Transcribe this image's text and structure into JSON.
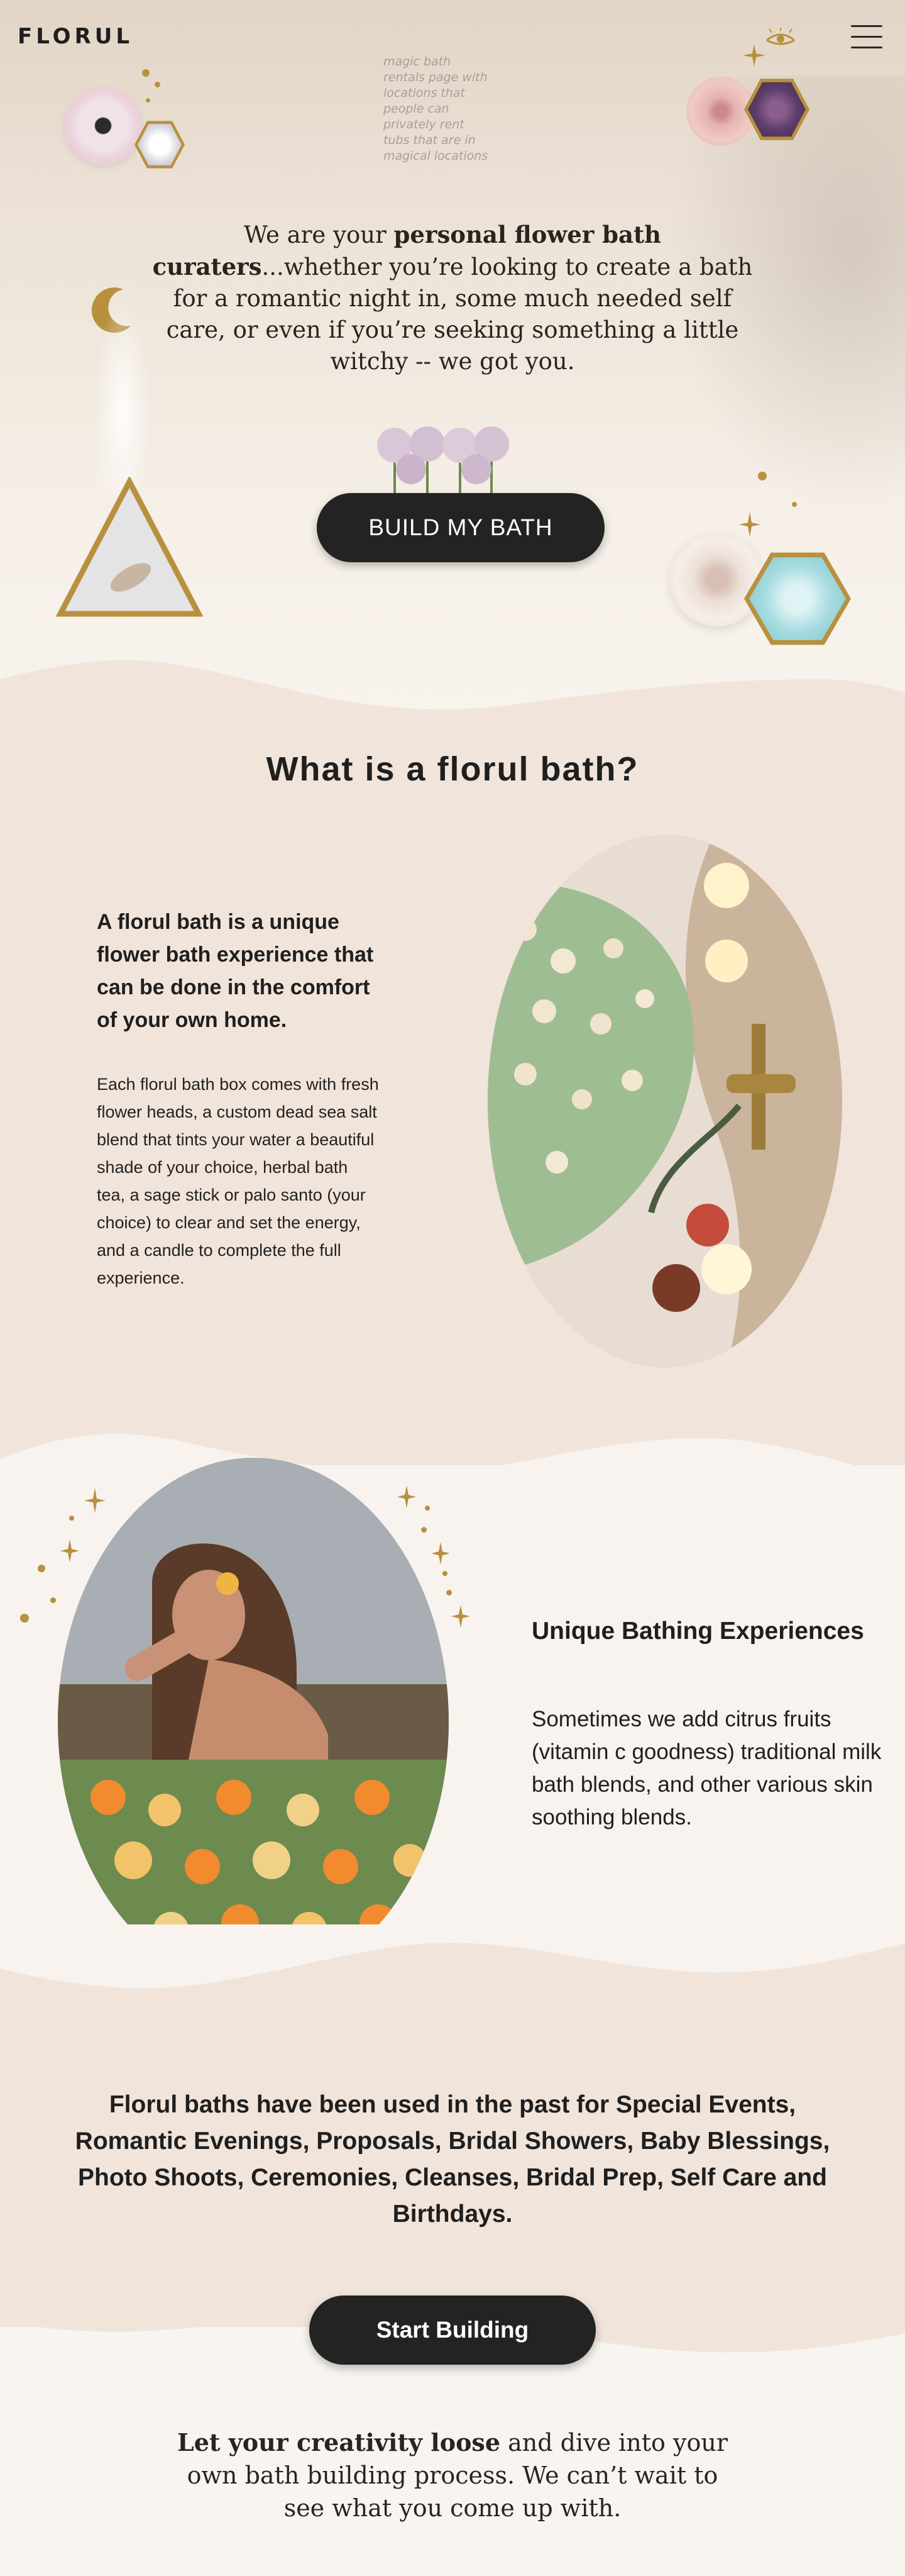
{
  "header": {
    "logo": "FLORUL",
    "note": "magic bath rentals page with locations that people can privately rent tubs that are in magical locations"
  },
  "hero": {
    "copy_bold": "personal flower bath curaters",
    "copy_before": "We are your ",
    "copy_after": "...whether you’re looking to create a bath for a romantic night in, some much needed self care, or even if you’re seeking something a little witchy -- we got you.",
    "button_label": "BUILD MY BATH"
  },
  "about": {
    "title": "What is a florul bath?",
    "lead": "A florul bath is a unique flower bath experience that can be done in the comfort of your own home.",
    "body": "Each florul bath box comes with fresh flower heads, a custom dead sea salt blend that tints your water a beautiful shade of your choice, herbal bath tea, a sage stick or palo santo (your choice) to clear and set the energy, and a candle to complete the full experience."
  },
  "unique": {
    "heading": "Unique Bathing Experiences",
    "body": "Sometimes we add citrus fruits (vitamin c goodness) traditional milk bath blends, and other various skin soothing blends."
  },
  "occasions": {
    "text": "Florul baths have been used in the past for Special Events, Romantic Evenings, Proposals, Bridal Showers, Baby Blessings, Photo Shoots, Ceremonies, Cleanses, Bridal Prep, Self Care and Birthdays.",
    "button_label": "Start Building"
  },
  "footer": {
    "copy_bold": "Let your creativity loose",
    "copy_after": " and dive into your own bath building process. We can’t wait to see what you come up with."
  },
  "icons": [
    "menu-icon",
    "moon-icon",
    "eye-icon",
    "sparkle-icon",
    "flower-icon",
    "triangle-frame-icon",
    "hexagon-frame-icon"
  ],
  "colors": {
    "accent_gold": "#b8913f",
    "button_dark": "#232323",
    "section_beige": "#f1e4da",
    "section_light": "#f8f3ee"
  }
}
